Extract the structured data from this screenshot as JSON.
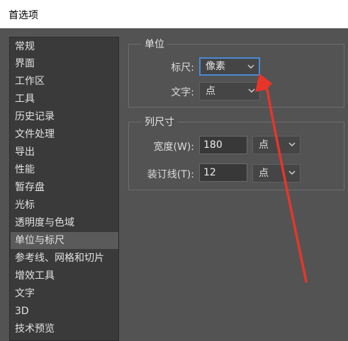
{
  "window": {
    "title": "首选项"
  },
  "sidebar": {
    "items": [
      {
        "label": "常规"
      },
      {
        "label": "界面"
      },
      {
        "label": "工作区"
      },
      {
        "label": "工具"
      },
      {
        "label": "历史记录"
      },
      {
        "label": "文件处理"
      },
      {
        "label": "导出"
      },
      {
        "label": "性能"
      },
      {
        "label": "暂存盘"
      },
      {
        "label": "光标"
      },
      {
        "label": "透明度与色域"
      },
      {
        "label": "单位与标尺"
      },
      {
        "label": "参考线、网格和切片"
      },
      {
        "label": "增效工具"
      },
      {
        "label": "文字"
      },
      {
        "label": "3D"
      },
      {
        "label": "技术预览"
      }
    ],
    "selected": "单位与标尺"
  },
  "units": {
    "title": "单位",
    "ruler_label": "标尺:",
    "ruler_value": "像素",
    "type_label": "文字:",
    "type_value": "点"
  },
  "column": {
    "title": "列尺寸",
    "width_label": "宽度(W):",
    "width_value": "180",
    "width_unit": "点",
    "gutter_label": "装订线(T):",
    "gutter_value": "12",
    "gutter_unit": "点"
  },
  "colors": {
    "background": "#535353",
    "focus_border": "#4a8ad4",
    "annotation_arrow": "#e8352a"
  }
}
